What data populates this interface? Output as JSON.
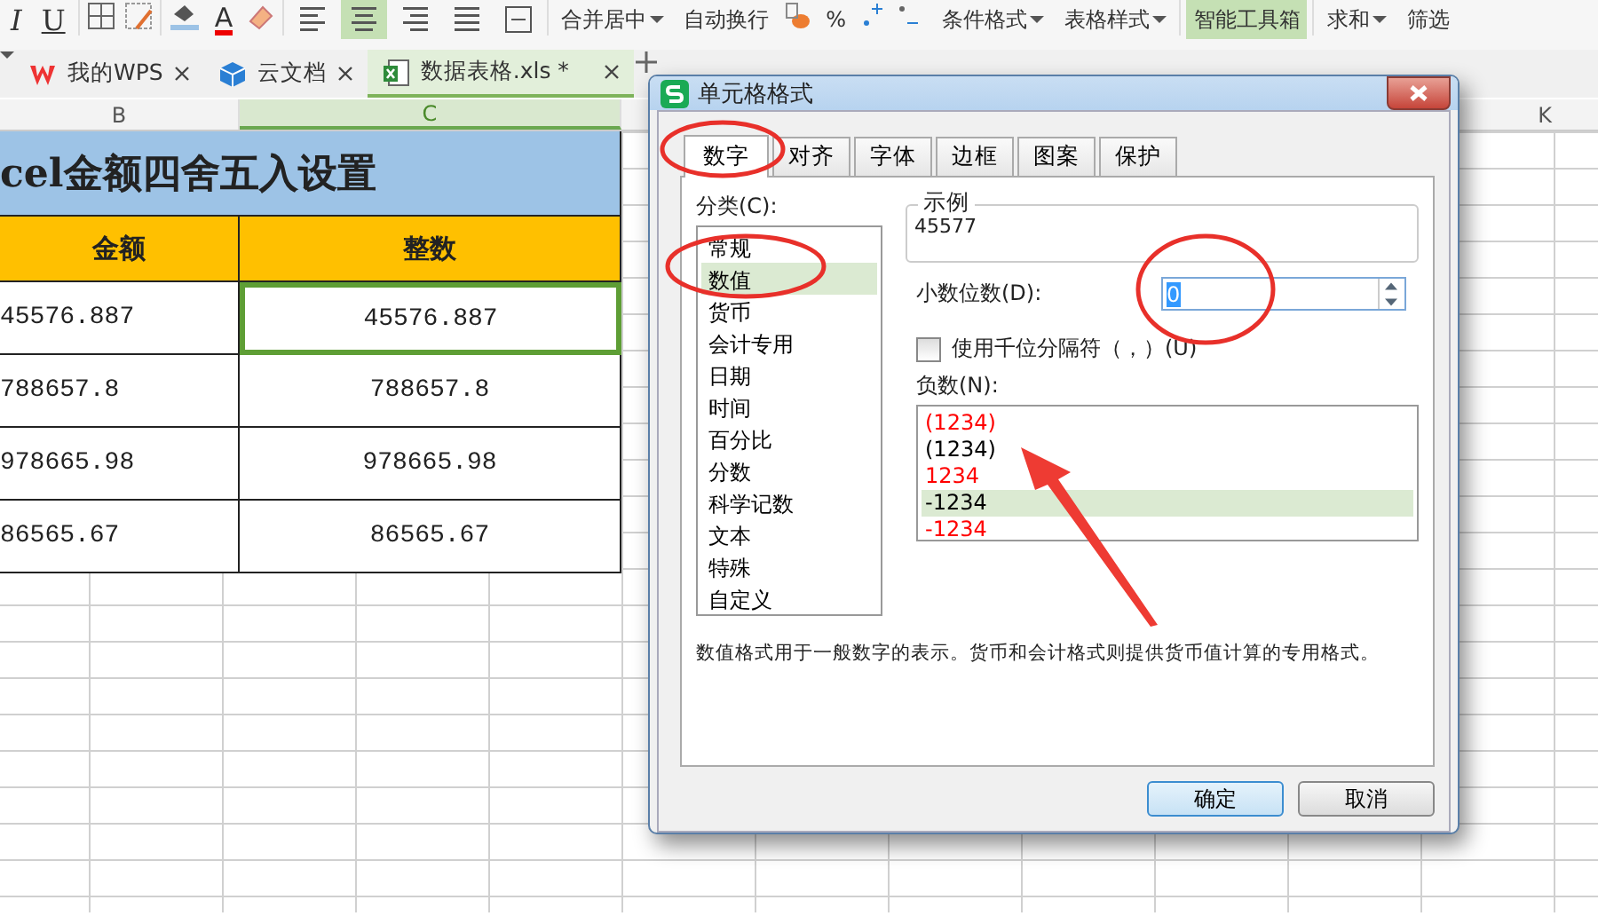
{
  "toolbar": {
    "glyph_buttons": [
      "I",
      "U"
    ],
    "font_color_glyph": "A",
    "align_buttons": [
      {
        "selected": false
      },
      {
        "selected": true
      },
      {
        "selected": false
      },
      {
        "selected": false
      },
      {
        "selected": false
      }
    ],
    "items": [
      {
        "label": "合并居中",
        "dropdown": true,
        "selected": false
      },
      {
        "label": "自动换行",
        "dropdown": false,
        "selected": false
      },
      {
        "label": "%",
        "dropdown": false,
        "selected": false
      },
      {
        "label": "条件格式",
        "dropdown": true,
        "selected": false
      },
      {
        "label": "表格样式",
        "dropdown": true,
        "selected": false
      },
      {
        "label": "智能工具箱",
        "dropdown": false,
        "selected": true
      },
      {
        "label": "求和",
        "dropdown": true,
        "selected": false
      },
      {
        "label": "筛选",
        "dropdown": false,
        "selected": false
      }
    ]
  },
  "tabs": [
    {
      "label": "我的WPS",
      "kind": "wps",
      "selected": false
    },
    {
      "label": "云文档",
      "kind": "cloud",
      "selected": false
    },
    {
      "label": "数据表格.xls *",
      "kind": "sheet",
      "selected": true
    }
  ],
  "sheet": {
    "columns": [
      {
        "label": "B",
        "selected": false
      },
      {
        "label": "C",
        "selected": true
      }
    ],
    "far_column": "K",
    "title": "cel金额四舍五入设置",
    "headers": [
      "金额",
      "整数"
    ],
    "rows": [
      [
        {
          "text": "45576.887",
          "selected": false
        },
        {
          "text": "45576.887",
          "selected": true
        }
      ],
      [
        {
          "text": "788657.8",
          "selected": false
        },
        {
          "text": "788657.8",
          "selected": false
        }
      ],
      [
        {
          "text": "978665.98",
          "selected": false
        },
        {
          "text": "978665.98",
          "selected": false
        }
      ],
      [
        {
          "text": "86565.67",
          "selected": false
        },
        {
          "text": "86565.67",
          "selected": false
        }
      ]
    ]
  },
  "dialog": {
    "title": "单元格格式",
    "tabs": [
      {
        "label": "数字",
        "selected": true
      },
      {
        "label": "对齐",
        "selected": false
      },
      {
        "label": "字体",
        "selected": false
      },
      {
        "label": "边框",
        "selected": false
      },
      {
        "label": "图案",
        "selected": false
      },
      {
        "label": "保护",
        "selected": false
      }
    ],
    "category_label": "分类(C):",
    "categories": [
      {
        "label": "常规",
        "selected": false
      },
      {
        "label": "数值",
        "selected": true
      },
      {
        "label": "货币",
        "selected": false
      },
      {
        "label": "会计专用",
        "selected": false
      },
      {
        "label": "日期",
        "selected": false
      },
      {
        "label": "时间",
        "selected": false
      },
      {
        "label": "百分比",
        "selected": false
      },
      {
        "label": "分数",
        "selected": false
      },
      {
        "label": "科学记数",
        "selected": false
      },
      {
        "label": "文本",
        "selected": false
      },
      {
        "label": "特殊",
        "selected": false
      },
      {
        "label": "自定义",
        "selected": false
      }
    ],
    "sample_label": "示例",
    "sample_value": "45577",
    "decimals_label": "小数位数(D):",
    "decimals_value": "0",
    "thousands": {
      "label": "使用千位分隔符（，）(U)",
      "checked": false
    },
    "negative_label": "负数(N):",
    "negatives": [
      {
        "text": "(1234)",
        "color": "#ff0000",
        "selected": false
      },
      {
        "text": "(1234)",
        "color": "#000000",
        "selected": false
      },
      {
        "text": "1234",
        "color": "#ff0000",
        "selected": false
      },
      {
        "text": "-1234",
        "color": "#000000",
        "selected": true
      },
      {
        "text": "-1234",
        "color": "#ff0000",
        "selected": false
      }
    ],
    "description": "数值格式用于一般数字的表示。货币和会计格式则提供货币值计算的专用格式。",
    "buttons": [
      {
        "label": "确定",
        "kind": "default"
      },
      {
        "label": "取消",
        "kind": "normal"
      }
    ]
  }
}
